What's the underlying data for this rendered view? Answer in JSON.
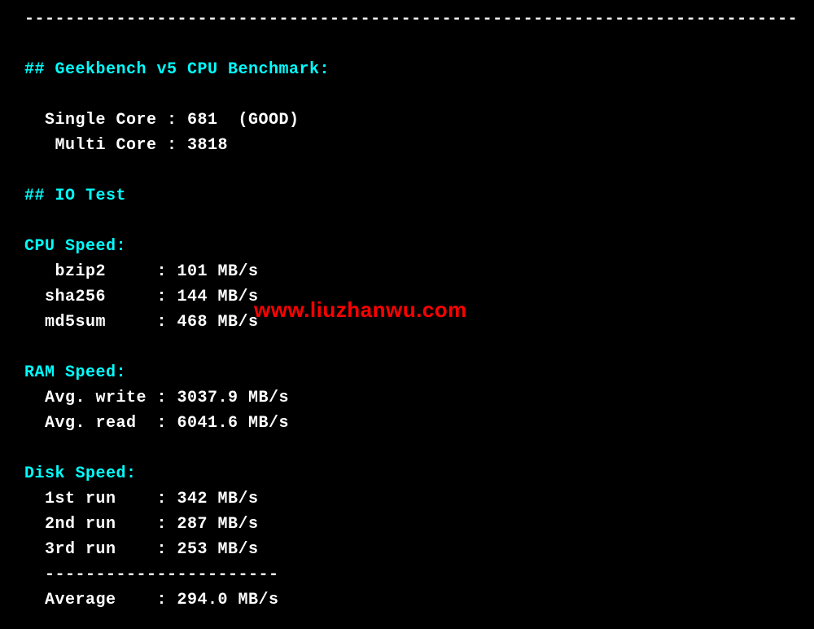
{
  "top_dash": "----------------------------------------------------------------------------",
  "sections": {
    "geekbench": {
      "heading": "## Geekbench v5 CPU Benchmark:",
      "single_core_line": "  Single Core : 681  (GOOD)",
      "multi_core_line": "   Multi Core : 3818"
    },
    "io_test": {
      "heading": "## IO Test"
    },
    "cpu_speed": {
      "heading": "CPU Speed:",
      "bzip2_line": "   bzip2     : 101 MB/s",
      "sha256_line": "  sha256     : 144 MB/s",
      "md5sum_line": "  md5sum     : 468 MB/s"
    },
    "ram_speed": {
      "heading": "RAM Speed:",
      "avg_write_line": "  Avg. write : 3037.9 MB/s",
      "avg_read_line": "  Avg. read  : 6041.6 MB/s"
    },
    "disk_speed": {
      "heading": "Disk Speed:",
      "run1_line": "  1st run    : 342 MB/s",
      "run2_line": "  2nd run    : 287 MB/s",
      "run3_line": "  3rd run    : 253 MB/s",
      "dash_line": "  -----------------------",
      "average_line": "  Average    : 294.0 MB/s"
    }
  },
  "watermark": "www.liuzhanwu.com"
}
